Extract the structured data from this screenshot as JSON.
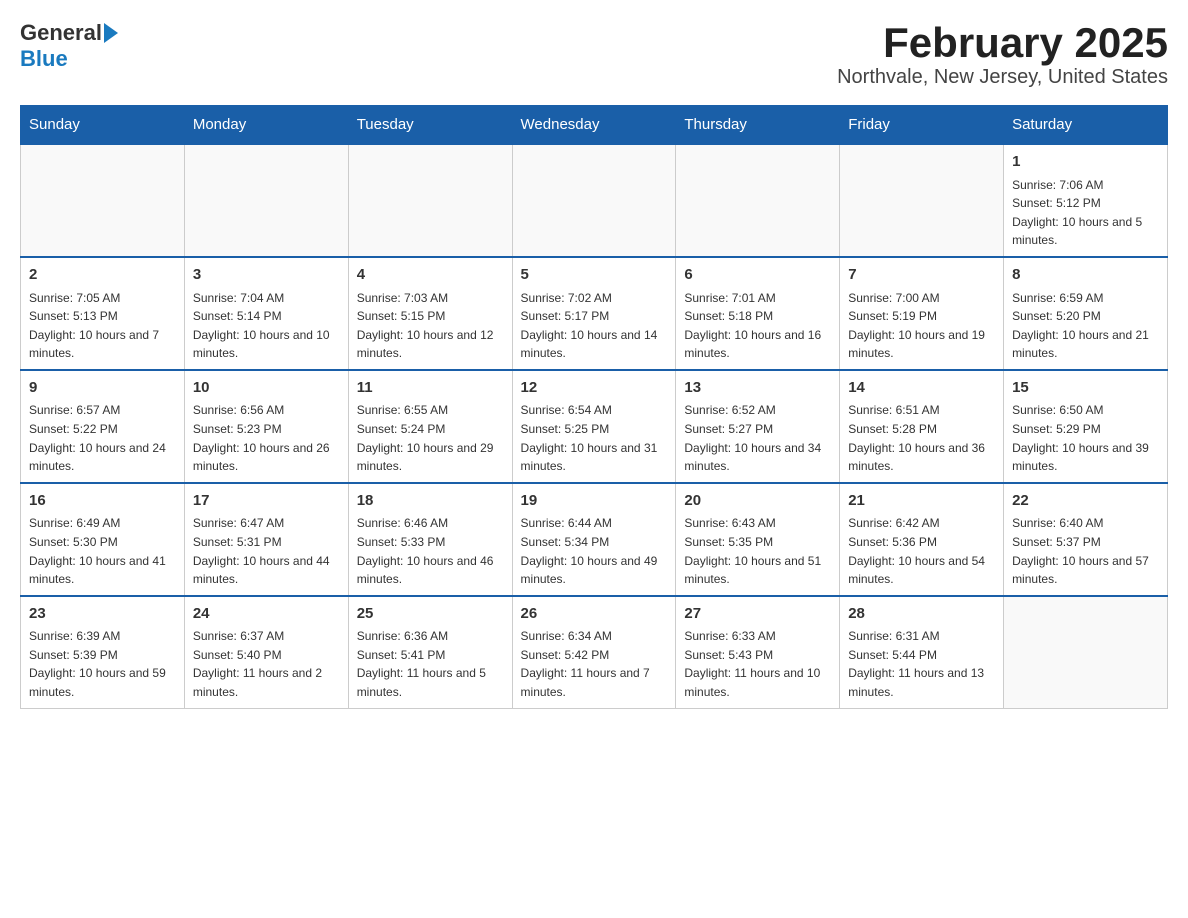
{
  "header": {
    "logo": {
      "general": "General",
      "blue": "Blue",
      "arrow": "▶"
    },
    "title": "February 2025",
    "subtitle": "Northvale, New Jersey, United States"
  },
  "days_of_week": [
    "Sunday",
    "Monday",
    "Tuesday",
    "Wednesday",
    "Thursday",
    "Friday",
    "Saturday"
  ],
  "weeks": [
    [
      {
        "day": "",
        "info": ""
      },
      {
        "day": "",
        "info": ""
      },
      {
        "day": "",
        "info": ""
      },
      {
        "day": "",
        "info": ""
      },
      {
        "day": "",
        "info": ""
      },
      {
        "day": "",
        "info": ""
      },
      {
        "day": "1",
        "info": "Sunrise: 7:06 AM\nSunset: 5:12 PM\nDaylight: 10 hours and 5 minutes."
      }
    ],
    [
      {
        "day": "2",
        "info": "Sunrise: 7:05 AM\nSunset: 5:13 PM\nDaylight: 10 hours and 7 minutes."
      },
      {
        "day": "3",
        "info": "Sunrise: 7:04 AM\nSunset: 5:14 PM\nDaylight: 10 hours and 10 minutes."
      },
      {
        "day": "4",
        "info": "Sunrise: 7:03 AM\nSunset: 5:15 PM\nDaylight: 10 hours and 12 minutes."
      },
      {
        "day": "5",
        "info": "Sunrise: 7:02 AM\nSunset: 5:17 PM\nDaylight: 10 hours and 14 minutes."
      },
      {
        "day": "6",
        "info": "Sunrise: 7:01 AM\nSunset: 5:18 PM\nDaylight: 10 hours and 16 minutes."
      },
      {
        "day": "7",
        "info": "Sunrise: 7:00 AM\nSunset: 5:19 PM\nDaylight: 10 hours and 19 minutes."
      },
      {
        "day": "8",
        "info": "Sunrise: 6:59 AM\nSunset: 5:20 PM\nDaylight: 10 hours and 21 minutes."
      }
    ],
    [
      {
        "day": "9",
        "info": "Sunrise: 6:57 AM\nSunset: 5:22 PM\nDaylight: 10 hours and 24 minutes."
      },
      {
        "day": "10",
        "info": "Sunrise: 6:56 AM\nSunset: 5:23 PM\nDaylight: 10 hours and 26 minutes."
      },
      {
        "day": "11",
        "info": "Sunrise: 6:55 AM\nSunset: 5:24 PM\nDaylight: 10 hours and 29 minutes."
      },
      {
        "day": "12",
        "info": "Sunrise: 6:54 AM\nSunset: 5:25 PM\nDaylight: 10 hours and 31 minutes."
      },
      {
        "day": "13",
        "info": "Sunrise: 6:52 AM\nSunset: 5:27 PM\nDaylight: 10 hours and 34 minutes."
      },
      {
        "day": "14",
        "info": "Sunrise: 6:51 AM\nSunset: 5:28 PM\nDaylight: 10 hours and 36 minutes."
      },
      {
        "day": "15",
        "info": "Sunrise: 6:50 AM\nSunset: 5:29 PM\nDaylight: 10 hours and 39 minutes."
      }
    ],
    [
      {
        "day": "16",
        "info": "Sunrise: 6:49 AM\nSunset: 5:30 PM\nDaylight: 10 hours and 41 minutes."
      },
      {
        "day": "17",
        "info": "Sunrise: 6:47 AM\nSunset: 5:31 PM\nDaylight: 10 hours and 44 minutes."
      },
      {
        "day": "18",
        "info": "Sunrise: 6:46 AM\nSunset: 5:33 PM\nDaylight: 10 hours and 46 minutes."
      },
      {
        "day": "19",
        "info": "Sunrise: 6:44 AM\nSunset: 5:34 PM\nDaylight: 10 hours and 49 minutes."
      },
      {
        "day": "20",
        "info": "Sunrise: 6:43 AM\nSunset: 5:35 PM\nDaylight: 10 hours and 51 minutes."
      },
      {
        "day": "21",
        "info": "Sunrise: 6:42 AM\nSunset: 5:36 PM\nDaylight: 10 hours and 54 minutes."
      },
      {
        "day": "22",
        "info": "Sunrise: 6:40 AM\nSunset: 5:37 PM\nDaylight: 10 hours and 57 minutes."
      }
    ],
    [
      {
        "day": "23",
        "info": "Sunrise: 6:39 AM\nSunset: 5:39 PM\nDaylight: 10 hours and 59 minutes."
      },
      {
        "day": "24",
        "info": "Sunrise: 6:37 AM\nSunset: 5:40 PM\nDaylight: 11 hours and 2 minutes."
      },
      {
        "day": "25",
        "info": "Sunrise: 6:36 AM\nSunset: 5:41 PM\nDaylight: 11 hours and 5 minutes."
      },
      {
        "day": "26",
        "info": "Sunrise: 6:34 AM\nSunset: 5:42 PM\nDaylight: 11 hours and 7 minutes."
      },
      {
        "day": "27",
        "info": "Sunrise: 6:33 AM\nSunset: 5:43 PM\nDaylight: 11 hours and 10 minutes."
      },
      {
        "day": "28",
        "info": "Sunrise: 6:31 AM\nSunset: 5:44 PM\nDaylight: 11 hours and 13 minutes."
      },
      {
        "day": "",
        "info": ""
      }
    ]
  ]
}
